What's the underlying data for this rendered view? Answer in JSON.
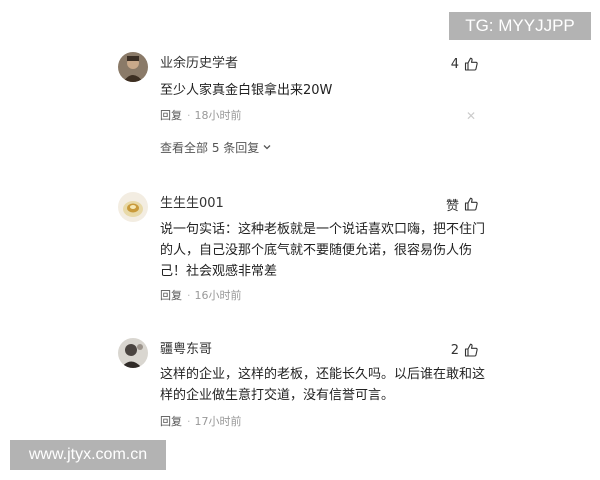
{
  "watermarks": {
    "top": "TG: MYYJJPP",
    "bottom": "www.jtyx.com.cn"
  },
  "comments": [
    {
      "user": "业余历史学者",
      "likes": "4",
      "lines": [
        "至少人家真金白银拿出来20W"
      ],
      "reply_label": "回复",
      "time": "18小时前",
      "view_all": "查看全部 5 条回复"
    },
    {
      "user": "生生生001",
      "likes": "赞",
      "lines": [
        "说一句实话：这种老板就是一个说话喜欢口嗨，把不住门",
        "的人，自己没那个底气就不要随便允诺，很容易伤人伤",
        "己！社会观感非常差"
      ],
      "reply_label": "回复",
      "time": "16小时前"
    },
    {
      "user": "疆粤东哥",
      "likes": "2",
      "lines": [
        "这样的企业，这样的老板，还能长久吗。以后谁在敢和这",
        "样的企业做生意打交道，没有信誉可言。"
      ],
      "reply_label": "回复",
      "time": "17小时前"
    }
  ],
  "icons": {
    "like": "thumbs-up-icon",
    "dismiss": "close-icon",
    "expand": "chevron-down-icon"
  }
}
